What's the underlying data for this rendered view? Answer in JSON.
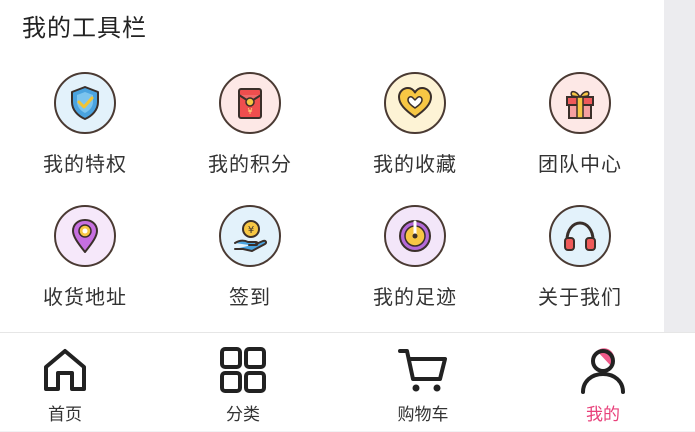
{
  "toolbar": {
    "title": "我的工具栏",
    "items": [
      {
        "label": "我的特权",
        "icon": "shield-check-icon",
        "bg": "#e3f2fb"
      },
      {
        "label": "我的积分",
        "icon": "red-envelope-icon",
        "bg": "#fde8e6"
      },
      {
        "label": "我的收藏",
        "icon": "heart-icon",
        "bg": "#fdf3d5"
      },
      {
        "label": "团队中心",
        "icon": "gift-box-icon",
        "bg": "#fde8e6"
      },
      {
        "label": "收货地址",
        "icon": "location-pin-icon",
        "bg": "#f6e8fa"
      },
      {
        "label": "签到",
        "icon": "coin-hand-icon",
        "bg": "#e3f2fb"
      },
      {
        "label": "我的足迹",
        "icon": "footprint-dial-icon",
        "bg": "#f3e6f9"
      },
      {
        "label": "关于我们",
        "icon": "headphones-icon",
        "bg": "#e3f2fb"
      }
    ]
  },
  "tabbar": {
    "items": [
      {
        "label": "首页",
        "icon": "home-icon"
      },
      {
        "label": "分类",
        "icon": "grid-icon"
      },
      {
        "label": "购物车",
        "icon": "cart-icon"
      },
      {
        "label": "我的",
        "icon": "user-icon",
        "active": true
      }
    ],
    "active_color": "#e8407a"
  }
}
